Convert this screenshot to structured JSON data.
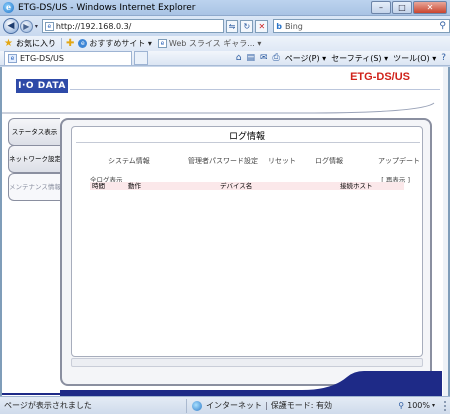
{
  "window": {
    "title": "ETG-DS/US - Windows Internet Explorer",
    "minimize_glyph": "–",
    "maximize_glyph": "□",
    "close_glyph": "✕"
  },
  "address_bar": {
    "back_glyph": "◀",
    "forward_glyph": "▶",
    "url": "http://192.168.0.3/",
    "search_engine": "Bing"
  },
  "favorites_bar": {
    "favorites_label": "お気に入り",
    "suggested_sites": "おすすめサイト ▾",
    "web_slice_gallery": "Web スライス ギャラ... ▾"
  },
  "command_bar": {
    "tab_title": "ETG-DS/US",
    "page_menu": "ページ(P) ▾",
    "safety_menu": "セーフティ(S) ▾",
    "tools_menu": "ツール(O) ▾",
    "help_menu": "?",
    "home_glyph": "⌂",
    "feeds_glyph": "▤",
    "mail_glyph": "✉",
    "print_glyph": "⎙"
  },
  "page": {
    "logo_text": "I·O DATA",
    "product_name": "ETG-DS/US",
    "sidebar": [
      {
        "label": "ステータス表示",
        "active": false
      },
      {
        "label": "ネットワーク設定",
        "active": false
      },
      {
        "label": "メンテナンス情報",
        "active": true
      }
    ],
    "panel_title": "ログ情報",
    "maintenance_tabs": [
      "システム情報",
      "管理者パスワード設定",
      "リセット",
      "ログ情報",
      "アップデート"
    ],
    "all_log_label": "全ログ表示",
    "redisplay_label": "[ 再表示 ]",
    "log_columns": [
      "時間",
      "動作",
      "デバイス名",
      "接続ホスト"
    ]
  },
  "status_bar": {
    "status_text": "ページが表示されました",
    "zone": "インターネット",
    "protected_mode": "保護モード: 有効",
    "zoom": "100%"
  },
  "colors": {
    "brand_blue": "#2e4aa8",
    "product_red": "#d0221a",
    "log_header_bg": "#fbe8ea"
  }
}
